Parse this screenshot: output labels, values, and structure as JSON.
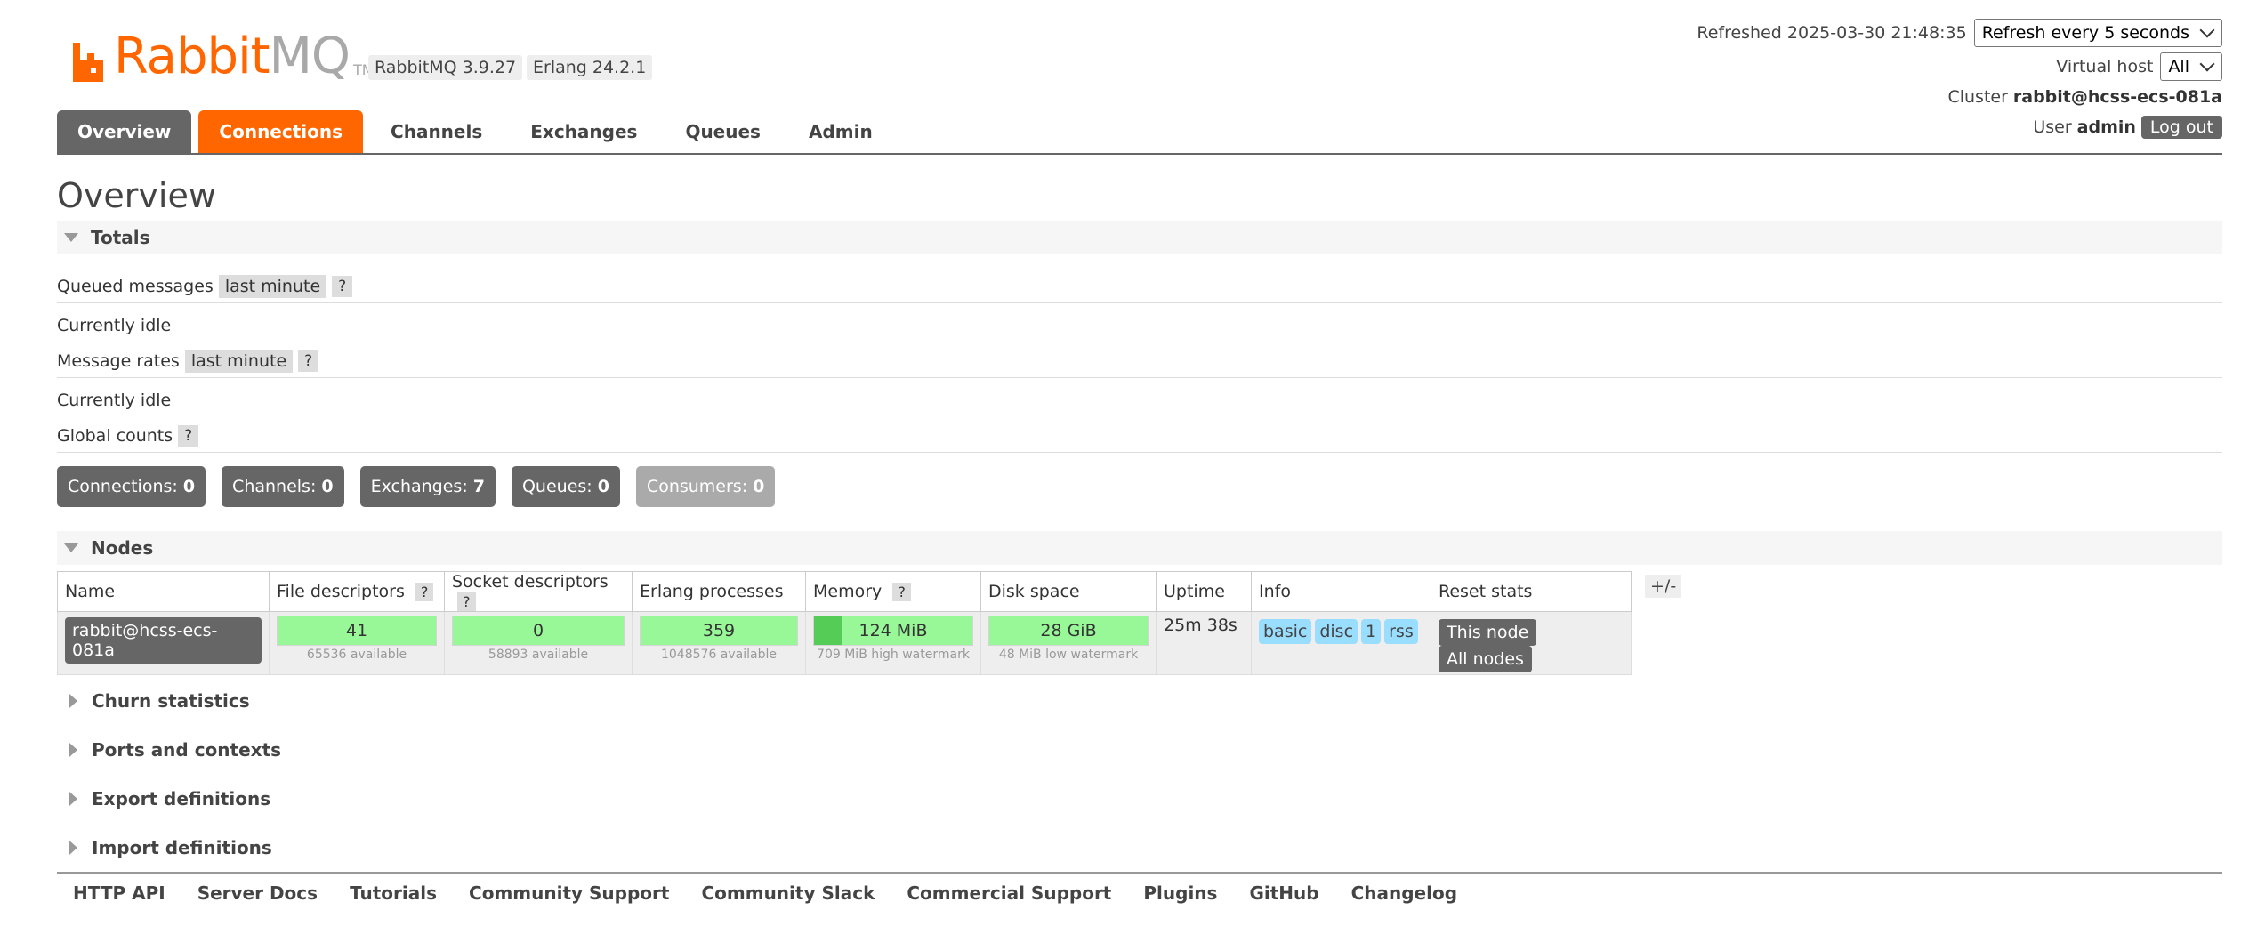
{
  "logo": {
    "word1": "Rabbit",
    "word2": "MQ",
    "tm": "TM"
  },
  "versions": {
    "rabbitmq": "RabbitMQ 3.9.27",
    "erlang": "Erlang 24.2.1"
  },
  "header": {
    "refreshed_label": "Refreshed 2025-03-30 21:48:35",
    "refresh_select": "Refresh every 5 seconds",
    "vhost_label": "Virtual host",
    "vhost_select": "All",
    "cluster_label": "Cluster",
    "cluster_name": "rabbit@hcss-ecs-081a",
    "user_label": "User",
    "user_name": "admin",
    "logout": "Log out"
  },
  "tabs": [
    "Overview",
    "Connections",
    "Channels",
    "Exchanges",
    "Queues",
    "Admin"
  ],
  "page_title": "Overview",
  "totals": {
    "header": "Totals",
    "queued_messages": "Queued messages",
    "queued_chip": "last minute",
    "help": "?",
    "idle1": "Currently idle",
    "message_rates": "Message rates",
    "rates_chip": "last minute",
    "idle2": "Currently idle",
    "global_counts": "Global counts",
    "counts": [
      {
        "label": "Connections:",
        "value": "0"
      },
      {
        "label": "Channels:",
        "value": "0"
      },
      {
        "label": "Exchanges:",
        "value": "7"
      },
      {
        "label": "Queues:",
        "value": "0"
      },
      {
        "label": "Consumers:",
        "value": "0"
      }
    ]
  },
  "nodes": {
    "header": "Nodes",
    "columns": [
      "Name",
      "File descriptors",
      "Socket descriptors",
      "Erlang processes",
      "Memory",
      "Disk space",
      "Uptime",
      "Info",
      "Reset stats"
    ],
    "row": {
      "name": "rabbit@hcss-ecs-081a",
      "fd": "41",
      "fd_sub": "65536 available",
      "sd": "0",
      "sd_sub": "58893 available",
      "ep": "359",
      "ep_sub": "1048576 available",
      "mem": "124 MiB",
      "mem_sub": "709 MiB high watermark",
      "mem_fraction": 0.175,
      "disk": "28 GiB",
      "disk_sub": "48 MiB low watermark",
      "uptime": "25m 38s",
      "info": [
        "basic",
        "disc",
        "1",
        "rss"
      ],
      "reset_this": "This node",
      "reset_all": "All nodes"
    },
    "plusminus": "+/-"
  },
  "sections": [
    "Churn statistics",
    "Ports and contexts",
    "Export definitions",
    "Import definitions"
  ],
  "footer": [
    "HTTP API",
    "Server Docs",
    "Tutorials",
    "Community Support",
    "Community Slack",
    "Commercial Support",
    "Plugins",
    "GitHub",
    "Changelog"
  ],
  "colors": {
    "brand": "#ff6600",
    "tab_active": "#666666",
    "bar_green": "#98f898",
    "info_badge": "#99ddff"
  }
}
